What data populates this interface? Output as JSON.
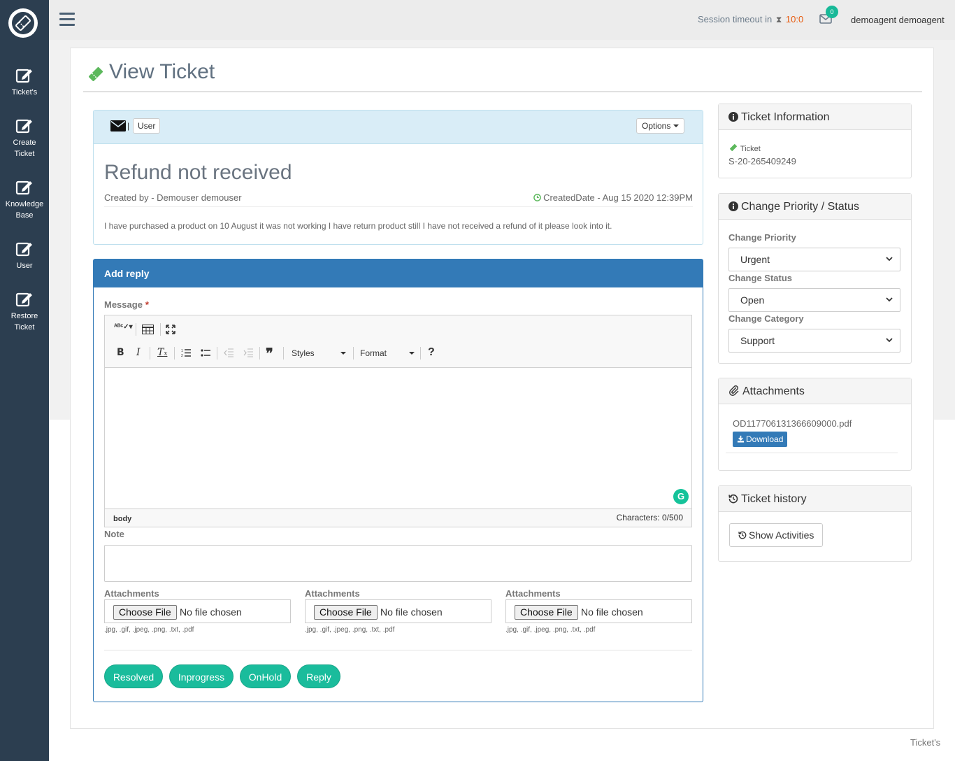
{
  "sidebar": {
    "items": [
      {
        "label": "Ticket's"
      },
      {
        "label": "Create Ticket"
      },
      {
        "label": "Knowledge Base"
      },
      {
        "label": "User"
      },
      {
        "label": "Restore Ticket"
      }
    ]
  },
  "topbar": {
    "session_label": "Session timeout in",
    "timer": "10:0",
    "mail_count": "0",
    "username": "demoagent demoagent"
  },
  "page": {
    "title": "View Ticket"
  },
  "ticket": {
    "user_badge": "User",
    "options_label": "Options",
    "subject": "Refund not received",
    "created_by": "Created by - Demouser demouser",
    "created_date": "CreatedDate - Aug 15 2020 12:39PM",
    "description": "I have purchased a product on 10 August it was not working I have return product still I have not received a refund of it please look into it."
  },
  "reply": {
    "title": "Add reply",
    "message_label": "Message",
    "required_mark": "*",
    "toolbar": {
      "styles": "Styles",
      "format": "Format"
    },
    "editor_path": "body",
    "char_count": "Characters: 0/500",
    "note_label": "Note",
    "attachments": [
      {
        "label": "Attachments",
        "button": "Choose File",
        "status": "No file chosen",
        "ext": ".jpg, .gif, .jpeg, .png, .txt, .pdf"
      },
      {
        "label": "Attachments",
        "button": "Choose File",
        "status": "No file chosen",
        "ext": ".jpg, .gif, .jpeg, .png, .txt, .pdf"
      },
      {
        "label": "Attachments",
        "button": "Choose File",
        "status": "No file chosen",
        "ext": ".jpg, .gif, .jpeg, .png, .txt, .pdf"
      }
    ],
    "buttons": {
      "resolved": "Resolved",
      "inprogress": "Inprogress",
      "onhold": "OnHold",
      "reply": "Reply"
    }
  },
  "ticket_info": {
    "title": "Ticket Information",
    "label": "Ticket",
    "number": "S-20-265409249"
  },
  "change": {
    "title": "Change Priority / Status",
    "priority_label": "Change Priority",
    "priority_value": "Urgent",
    "status_label": "Change Status",
    "status_value": "Open",
    "category_label": "Change Category",
    "category_value": "Support"
  },
  "attachments_panel": {
    "title": "Attachments",
    "file": "OD117706131366609000.pdf",
    "download": "Download"
  },
  "history": {
    "title": "Ticket history",
    "button": "Show Activities"
  },
  "footer": {
    "link": "Ticket's"
  },
  "colors": {
    "sidebar": "#2c3e50",
    "accent": "#1abc9c",
    "primary": "#337ab7",
    "timer": "#e8590c"
  }
}
